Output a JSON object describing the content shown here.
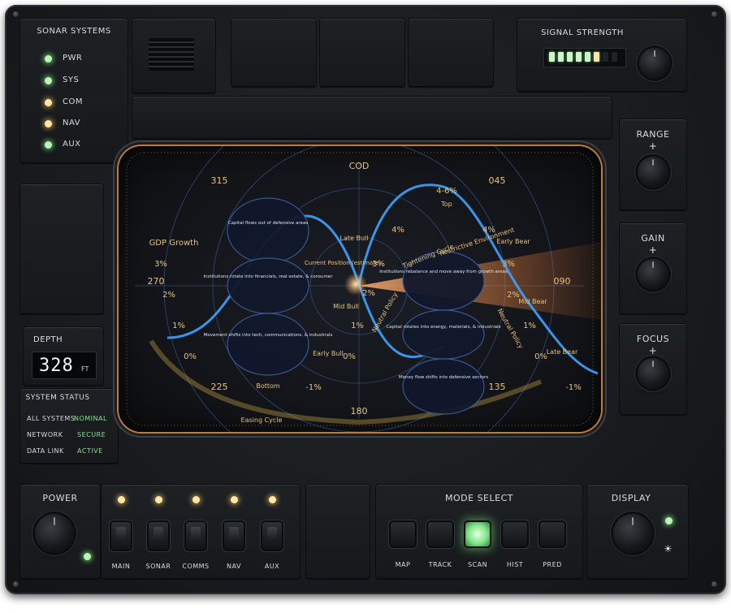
{
  "sonar_systems": {
    "title": "SONAR SYSTEMS",
    "items": [
      {
        "label": "PWR",
        "led": "green"
      },
      {
        "label": "SYS",
        "led": "green"
      },
      {
        "label": "COM",
        "led": "amber"
      },
      {
        "label": "NAV",
        "led": "amber"
      },
      {
        "label": "AUX",
        "led": "green"
      }
    ]
  },
  "signal_strength": {
    "title": "SIGNAL STRENGTH",
    "bars_lit": 6,
    "bars_total": 8
  },
  "controls": {
    "range": {
      "label": "RANGE",
      "plus": "+"
    },
    "gain": {
      "label": "GAIN",
      "plus": "+"
    },
    "focus": {
      "label": "FOCUS",
      "plus": "+"
    }
  },
  "depth": {
    "title": "DEPTH",
    "value": "328",
    "unit": "FT"
  },
  "system_status": {
    "title": "SYSTEM STATUS",
    "rows": [
      {
        "label": "ALL SYSTEMS",
        "value": "NOMINAL"
      },
      {
        "label": "NETWORK",
        "value": "SECURE"
      },
      {
        "label": "DATA LINK",
        "value": "ACTIVE"
      }
    ]
  },
  "screen": {
    "bearing_top": "COD",
    "bearing_315": "315",
    "bearing_045": "045",
    "bearing_270": "270",
    "bearing_090": "090",
    "bearing_225": "225",
    "bearing_135": "135",
    "bearing_180": "180",
    "gdp_label": "GDP Growth",
    "cycle_bottom": "Easing Cycle",
    "cycle_top": "Tightening Cycle",
    "restrictive": "Restrictive Environment",
    "neutral_policy_left": "Neutral Policy",
    "neutral_policy_right": "Neutral Policy",
    "current_position": "Current Position (estimate)",
    "top_value": "4-6%",
    "top": "Top",
    "bottom": "Bottom",
    "late_bull": "Late Bull",
    "mid_bull": "Mid Bull",
    "early_bull": "Early Bull",
    "early_bear": "Early Bear",
    "mid_bear": "Mid Bear",
    "late_bear": "Late Bear",
    "pct_3_left": "3%",
    "pct_2_left": "2%",
    "pct_1_left": "1%",
    "pct_0_left": "0%",
    "pct_4_a": "4%",
    "pct_4_b": "4%",
    "pct_3_a": "3%",
    "pct_3_b": "3%",
    "pct_2_mid": "2%",
    "pct_1_mid": "1%",
    "pct_0_mid": "0%",
    "pct_2_right": "2%",
    "pct_1_right": "1%",
    "pct_0_right": "0%",
    "neg1_mid": "-1%",
    "neg1_right": "-1%",
    "bubble_1": "Capital flows out of defensive areas",
    "bubble_2": "Institutions rotate into financials, real estate, & consumer",
    "bubble_3": "Movement shifts into tech, communications, & industrials",
    "bubble_4": "Institutions rebalance and move away from growth areas",
    "bubble_5": "Capital rotates into energy, materials, & industrials",
    "bubble_6": "Money flow shifts into defensive sectors"
  },
  "power": {
    "label": "POWER"
  },
  "switches": [
    {
      "label": "MAIN"
    },
    {
      "label": "SONAR"
    },
    {
      "label": "COMMS"
    },
    {
      "label": "NAV"
    },
    {
      "label": "AUX"
    }
  ],
  "mode_select": {
    "title": "MODE SELECT",
    "modes": [
      {
        "label": "MAP",
        "active": false
      },
      {
        "label": "TRACK",
        "active": false
      },
      {
        "label": "SCAN",
        "active": true
      },
      {
        "label": "HIST",
        "active": false
      },
      {
        "label": "PRED",
        "active": false
      }
    ]
  },
  "display": {
    "label": "DISPLAY"
  },
  "colors": {
    "accent_green": "#7fe58a",
    "accent_amber": "#e7c27d",
    "sonar_cyan": "#3fa2ff",
    "beam_orange": "#ff9a4a"
  }
}
